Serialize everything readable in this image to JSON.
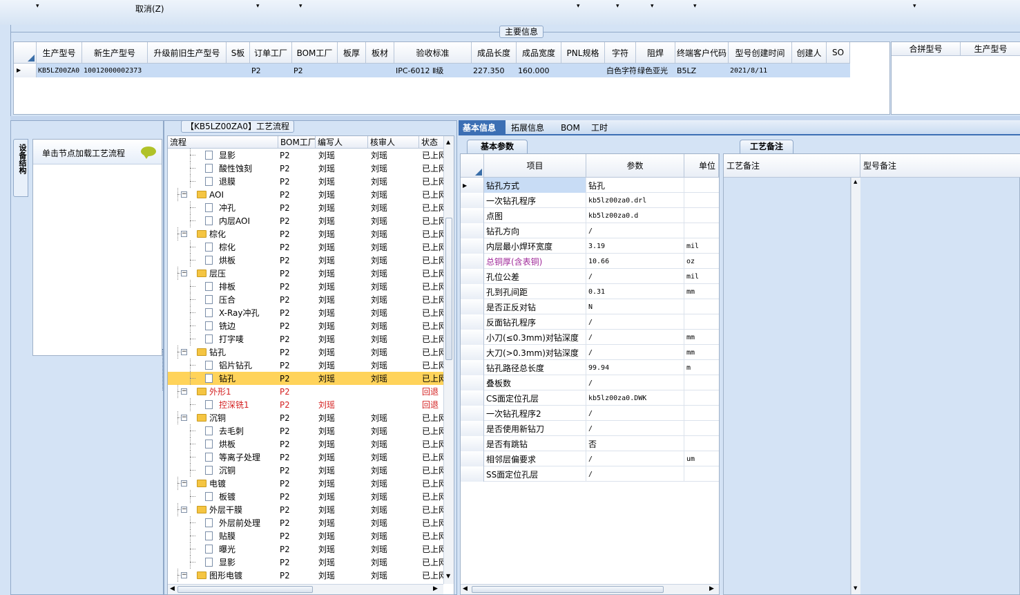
{
  "toolbar": {
    "cancel_label": "取消(Z)",
    "dropdown_marks": [
      "▾",
      "▾",
      "▾",
      "▾",
      "▾",
      "▾",
      "▾"
    ]
  },
  "main_info": {
    "section_title": "主要信息",
    "columns": [
      "生产型号",
      "新生产型号",
      "升级前旧生产型号",
      "S板",
      "订单工厂",
      "BOM工厂",
      "板厚",
      "板材",
      "验收标准",
      "成品长度",
      "成品宽度",
      "PNL规格",
      "字符",
      "阻焊",
      "终端客户代码",
      "型号创建时间",
      "创建人",
      "SO"
    ],
    "row": [
      "KB5LZ00ZA0",
      "10012000002373",
      "",
      "",
      "P2",
      "P2",
      "",
      "",
      "IPC-6012 Ⅱ级",
      "227.350",
      "160.000",
      "",
      "白色字符",
      "绿色亚光",
      "B5LZ",
      "2021/8/11",
      "",
      ""
    ],
    "side_columns": [
      "合拼型号",
      "生产型号"
    ]
  },
  "side_panel": {
    "vertical_tab": "设备结构",
    "hint": "单击节点加载工艺流程"
  },
  "flow": {
    "title": "【KB5LZ00ZA0】工艺流程",
    "columns": [
      "流程",
      "BOM工厂",
      "编写人",
      "核审人",
      "状态"
    ],
    "rows": [
      {
        "name": "显影",
        "level": 2,
        "bom": "P2",
        "writer": "刘瑶",
        "reviewer": "刘瑶",
        "status": "已上网"
      },
      {
        "name": "酸性蚀刻",
        "level": 2,
        "bom": "P2",
        "writer": "刘瑶",
        "reviewer": "刘瑶",
        "status": "已上网"
      },
      {
        "name": "退膜",
        "level": 2,
        "bom": "P2",
        "writer": "刘瑶",
        "reviewer": "刘瑶",
        "status": "已上网"
      },
      {
        "name": "AOI",
        "level": 1,
        "bom": "P2",
        "writer": "刘瑶",
        "reviewer": "刘瑶",
        "status": "已上网"
      },
      {
        "name": "冲孔",
        "level": 2,
        "bom": "P2",
        "writer": "刘瑶",
        "reviewer": "刘瑶",
        "status": "已上网"
      },
      {
        "name": "内层AOI",
        "level": 2,
        "bom": "P2",
        "writer": "刘瑶",
        "reviewer": "刘瑶",
        "status": "已上网"
      },
      {
        "name": "棕化",
        "level": 1,
        "bom": "P2",
        "writer": "刘瑶",
        "reviewer": "刘瑶",
        "status": "已上网"
      },
      {
        "name": "棕化",
        "level": 2,
        "bom": "P2",
        "writer": "刘瑶",
        "reviewer": "刘瑶",
        "status": "已上网"
      },
      {
        "name": "烘板",
        "level": 2,
        "bom": "P2",
        "writer": "刘瑶",
        "reviewer": "刘瑶",
        "status": "已上网"
      },
      {
        "name": "层压",
        "level": 1,
        "bom": "P2",
        "writer": "刘瑶",
        "reviewer": "刘瑶",
        "status": "已上网"
      },
      {
        "name": "排板",
        "level": 2,
        "bom": "P2",
        "writer": "刘瑶",
        "reviewer": "刘瑶",
        "status": "已上网"
      },
      {
        "name": "压合",
        "level": 2,
        "bom": "P2",
        "writer": "刘瑶",
        "reviewer": "刘瑶",
        "status": "已上网"
      },
      {
        "name": "X-Ray冲孔",
        "level": 2,
        "bom": "P2",
        "writer": "刘瑶",
        "reviewer": "刘瑶",
        "status": "已上网"
      },
      {
        "name": "铣边",
        "level": 2,
        "bom": "P2",
        "writer": "刘瑶",
        "reviewer": "刘瑶",
        "status": "已上网"
      },
      {
        "name": "打字唛",
        "level": 2,
        "bom": "P2",
        "writer": "刘瑶",
        "reviewer": "刘瑶",
        "status": "已上网"
      },
      {
        "name": "钻孔",
        "level": 1,
        "bom": "P2",
        "writer": "刘瑶",
        "reviewer": "刘瑶",
        "status": "已上网"
      },
      {
        "name": "铝片钻孔",
        "level": 2,
        "bom": "P2",
        "writer": "刘瑶",
        "reviewer": "刘瑶",
        "status": "已上网"
      },
      {
        "name": "钻孔",
        "level": 2,
        "bom": "P2",
        "writer": "刘瑶",
        "reviewer": "刘瑶",
        "status": "已上网",
        "selected": true
      },
      {
        "name": "外形1",
        "level": 1,
        "bom": "P2",
        "writer": "",
        "reviewer": "",
        "status": "回退",
        "red": true
      },
      {
        "name": "控深铣1",
        "level": 2,
        "bom": "P2",
        "writer": "刘瑶",
        "reviewer": "",
        "status": "回退",
        "red": true
      },
      {
        "name": "沉铜",
        "level": 1,
        "bom": "P2",
        "writer": "刘瑶",
        "reviewer": "刘瑶",
        "status": "已上网"
      },
      {
        "name": "去毛刺",
        "level": 2,
        "bom": "P2",
        "writer": "刘瑶",
        "reviewer": "刘瑶",
        "status": "已上网"
      },
      {
        "name": "烘板",
        "level": 2,
        "bom": "P2",
        "writer": "刘瑶",
        "reviewer": "刘瑶",
        "status": "已上网"
      },
      {
        "name": "等离子处理",
        "level": 2,
        "bom": "P2",
        "writer": "刘瑶",
        "reviewer": "刘瑶",
        "status": "已上网"
      },
      {
        "name": "沉铜",
        "level": 2,
        "bom": "P2",
        "writer": "刘瑶",
        "reviewer": "刘瑶",
        "status": "已上网"
      },
      {
        "name": "电镀",
        "level": 1,
        "bom": "P2",
        "writer": "刘瑶",
        "reviewer": "刘瑶",
        "status": "已上网"
      },
      {
        "name": "板镀",
        "level": 2,
        "bom": "P2",
        "writer": "刘瑶",
        "reviewer": "刘瑶",
        "status": "已上网"
      },
      {
        "name": "外层干膜",
        "level": 1,
        "bom": "P2",
        "writer": "刘瑶",
        "reviewer": "刘瑶",
        "status": "已上网"
      },
      {
        "name": "外层前处理",
        "level": 2,
        "bom": "P2",
        "writer": "刘瑶",
        "reviewer": "刘瑶",
        "status": "已上网"
      },
      {
        "name": "贴膜",
        "level": 2,
        "bom": "P2",
        "writer": "刘瑶",
        "reviewer": "刘瑶",
        "status": "已上网"
      },
      {
        "name": "曝光",
        "level": 2,
        "bom": "P2",
        "writer": "刘瑶",
        "reviewer": "刘瑶",
        "status": "已上网"
      },
      {
        "name": "显影",
        "level": 2,
        "bom": "P2",
        "writer": "刘瑶",
        "reviewer": "刘瑶",
        "status": "已上网"
      },
      {
        "name": "图形电镀",
        "level": 1,
        "bom": "P2",
        "writer": "刘瑶",
        "reviewer": "刘瑶",
        "status": "已上网"
      }
    ]
  },
  "detail_tabs": [
    "基本信息",
    "拓展信息",
    "BOM",
    "工时"
  ],
  "basic_params": {
    "title": "基本参数",
    "columns": [
      "项目",
      "参数",
      "单位"
    ],
    "rows": [
      {
        "item": "钻孔方式",
        "value": "钻孔",
        "unit": ""
      },
      {
        "item": "一次钻孔程序",
        "value": "kb5lz00za0.drl",
        "unit": ""
      },
      {
        "item": "点图",
        "value": "kb5lz00za0.d",
        "unit": ""
      },
      {
        "item": "钻孔方向",
        "value": "/",
        "unit": ""
      },
      {
        "item": "内层最小焊环宽度",
        "value": "3.19",
        "unit": "mil"
      },
      {
        "item": "总铜厚(含表铜)",
        "value": "10.66",
        "unit": "oz",
        "purple": true
      },
      {
        "item": "孔位公差",
        "value": "/",
        "unit": "mil"
      },
      {
        "item": "孔到孔间距",
        "value": "0.31",
        "unit": "mm"
      },
      {
        "item": "是否正反对钻",
        "value": "N",
        "unit": ""
      },
      {
        "item": "反面钻孔程序",
        "value": "/",
        "unit": ""
      },
      {
        "item": "小刀(≤0.3mm)对钻深度",
        "value": "/",
        "unit": "mm"
      },
      {
        "item": "大刀(>0.3mm)对钻深度",
        "value": "/",
        "unit": "mm"
      },
      {
        "item": "钻孔路径总长度",
        "value": "99.94",
        "unit": "m"
      },
      {
        "item": "叠板数",
        "value": "/",
        "unit": ""
      },
      {
        "item": "CS面定位孔层",
        "value": "kb5lz00za0.DWK",
        "unit": ""
      },
      {
        "item": "一次钻孔程序2",
        "value": "/",
        "unit": ""
      },
      {
        "item": "是否使用新钻刀",
        "value": "/",
        "unit": ""
      },
      {
        "item": "是否有跳钻",
        "value": "否",
        "unit": ""
      },
      {
        "item": "相邻层偏要求",
        "value": "/",
        "unit": "um"
      },
      {
        "item": "SS面定位孔层",
        "value": "/",
        "unit": ""
      }
    ]
  },
  "remarks": {
    "tab": "工艺备注",
    "columns": [
      "工艺备注",
      "型号备注"
    ]
  },
  "colors": {
    "selected_row": "#c8dcf5",
    "highlight": "#ffd35a",
    "red": "#d42020",
    "purple": "#a02a9a",
    "tab_active": "#3c6fb4"
  },
  "icons": {
    "comment": "speech-bubble-icon",
    "folder": "folder-icon",
    "doc": "document-icon"
  }
}
